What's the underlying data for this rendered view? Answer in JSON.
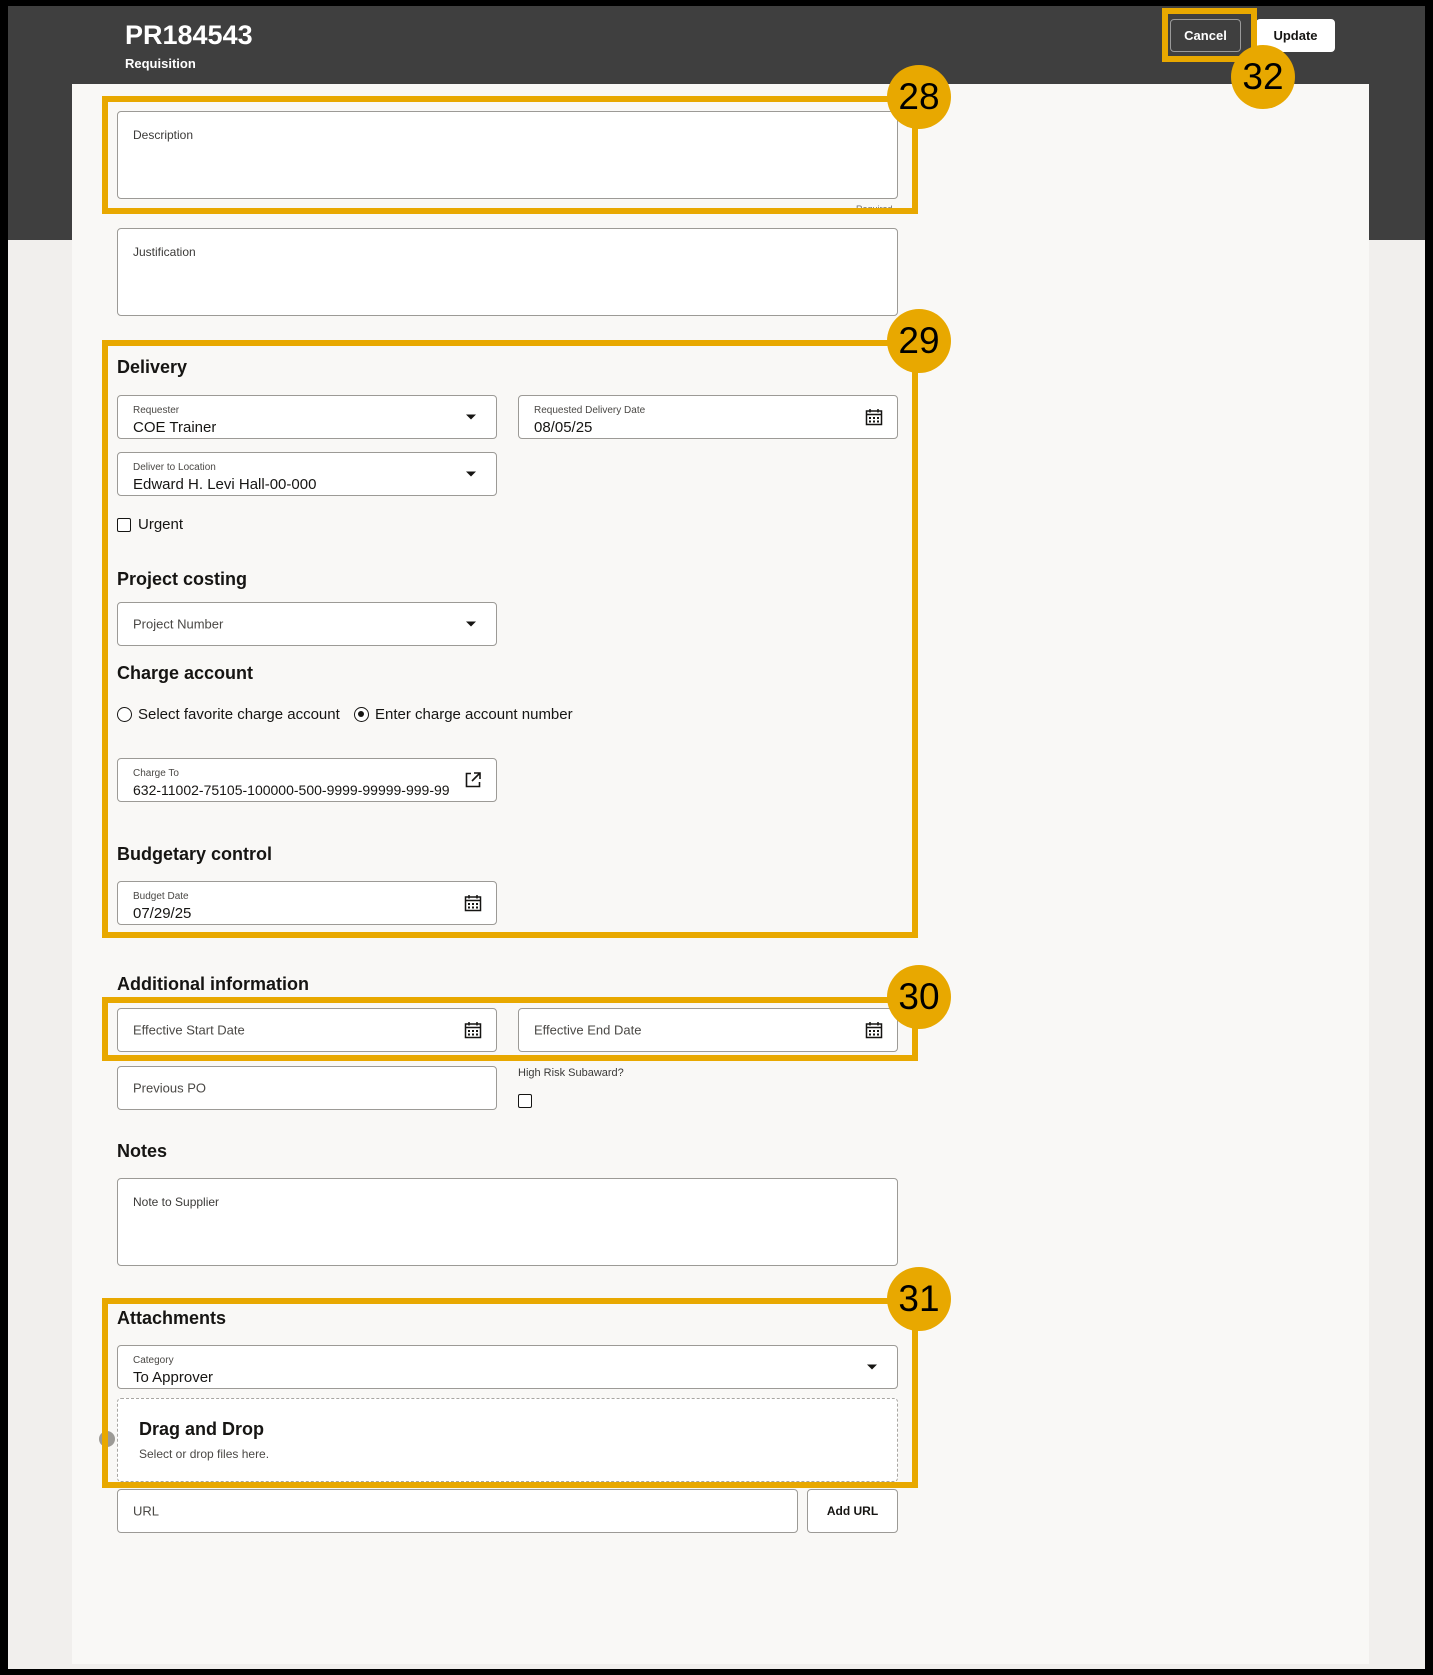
{
  "header": {
    "title": "PR184543",
    "subtitle": "Requisition",
    "cancel_label": "Cancel",
    "update_label": "Update"
  },
  "description": {
    "label": "Description",
    "hint": "Required"
  },
  "justification": {
    "label": "Justification"
  },
  "delivery": {
    "heading": "Delivery",
    "requester": {
      "label": "Requester",
      "value": "COE Trainer"
    },
    "requested_date": {
      "label": "Requested Delivery Date",
      "value": "08/05/25"
    },
    "deliver_to": {
      "label": "Deliver to Location",
      "value": "Edward H. Levi Hall-00-000"
    },
    "urgent_label": "Urgent"
  },
  "project_costing": {
    "heading": "Project costing",
    "project_number_label": "Project Number"
  },
  "charge_account": {
    "heading": "Charge account",
    "option_favorite": "Select favorite charge account",
    "option_enter": "Enter charge account number",
    "selected": "Enter charge account number",
    "charge_to": {
      "label": "Charge To",
      "value": "632-11002-75105-100000-500-9999-99999-999-99"
    }
  },
  "budgetary_control": {
    "heading": "Budgetary control",
    "budget_date": {
      "label": "Budget Date",
      "value": "07/29/25"
    }
  },
  "additional_info": {
    "heading": "Additional information",
    "start_label": "Effective Start Date",
    "end_label": "Effective End Date",
    "previous_po_label": "Previous PO",
    "high_risk_label": "High Risk Subaward?"
  },
  "notes": {
    "heading": "Notes",
    "note_label": "Note to Supplier"
  },
  "attachments": {
    "heading": "Attachments",
    "category": {
      "label": "Category",
      "value": "To Approver"
    },
    "drop_title": "Drag and Drop",
    "drop_subtitle": "Select or drop files here.",
    "url_label": "URL",
    "add_url_label": "Add URL"
  },
  "callouts": [
    "28",
    "29",
    "30",
    "31",
    "32"
  ],
  "colors": {
    "header_bg": "#3f3f3f",
    "highlight": "#e8a800",
    "panel_bg": "#f9f8f6"
  }
}
